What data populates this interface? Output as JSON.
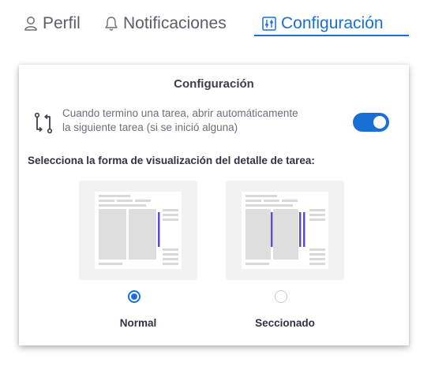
{
  "tabs": [
    {
      "label": "Perfil",
      "icon": "user-icon"
    },
    {
      "label": "Notificaciones",
      "icon": "bell-icon"
    },
    {
      "label": "Configuración",
      "icon": "sliders-icon",
      "active": true
    }
  ],
  "colors": {
    "accent": "#1a6fd6",
    "preview_bar": "#5b4fd0"
  },
  "card": {
    "title": "Configuración",
    "auto_next": {
      "line1": "Cuando termino una tarea, abrir automáticamente",
      "line2": "la siguiente tarea (si se inició alguna)",
      "enabled": true,
      "icon": "flow-icon"
    },
    "view_label": "Selecciona la forma de visualización del detalle de tarea:",
    "options": [
      {
        "label": "Normal",
        "selected": true
      },
      {
        "label": "Seccionado",
        "selected": false
      }
    ]
  }
}
